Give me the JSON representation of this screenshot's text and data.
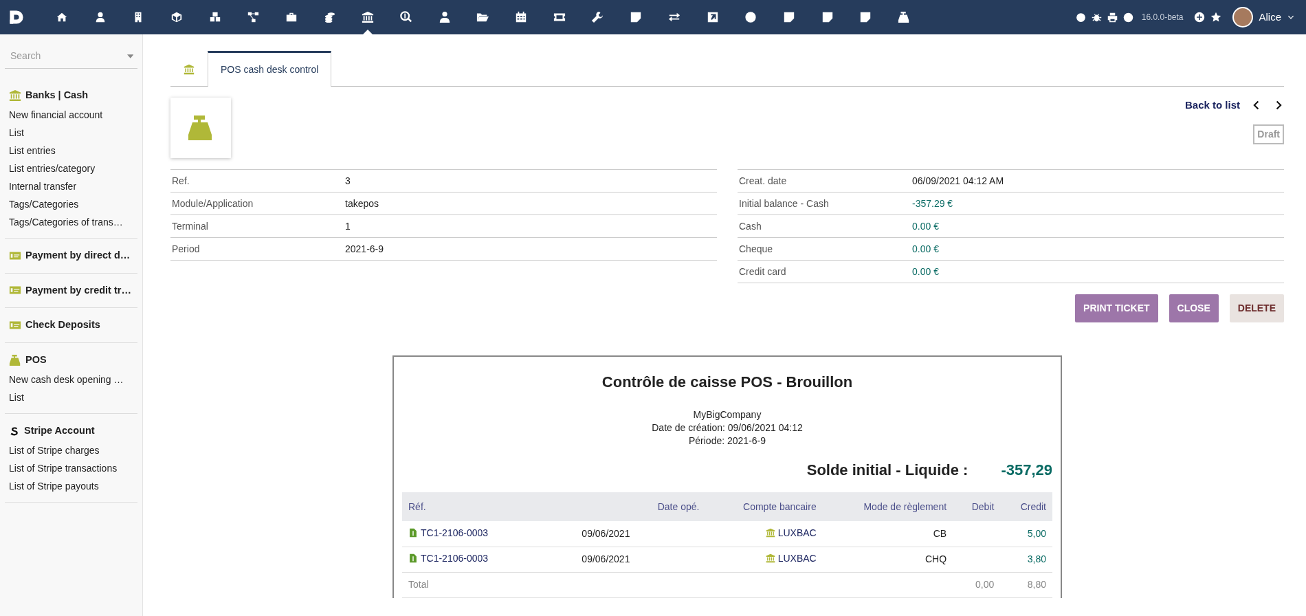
{
  "topbar": {
    "menu": [
      {
        "selected": false
      },
      {
        "selected": false
      },
      {
        "selected": false
      },
      {
        "selected": false
      },
      {
        "selected": false
      },
      {
        "selected": false
      },
      {
        "selected": false
      },
      {
        "selected": false
      },
      {
        "selected": true
      },
      {
        "selected": false
      },
      {
        "selected": false
      },
      {
        "selected": false
      },
      {
        "selected": false
      },
      {
        "selected": false
      },
      {
        "selected": false
      },
      {
        "selected": false
      },
      {
        "selected": false
      },
      {
        "selected": false
      },
      {
        "selected": false
      },
      {
        "selected": false
      },
      {
        "selected": false
      },
      {
        "selected": false
      },
      {
        "selected": false
      }
    ],
    "version": "16.0.0-beta",
    "user": "Alice"
  },
  "sidebar": {
    "search": {
      "placeholder": "Search"
    },
    "sections": [
      {
        "title": "Banks | Cash",
        "kind": "bank",
        "items": [
          "New financial account",
          "List",
          "List entries",
          "List entries/category",
          "Internal transfer",
          "Tags/Categories",
          "Tags/Categories of trans…"
        ]
      },
      {
        "title": "Payment by direct d…",
        "kind": "card"
      },
      {
        "title": "Payment by credit tr…",
        "kind": "card"
      },
      {
        "title": "Check Deposits",
        "kind": "card"
      },
      {
        "title": "POS",
        "kind": "register",
        "items": [
          "New cash desk opening …",
          "List"
        ]
      },
      {
        "title": "Stripe Account",
        "kind": "stripe",
        "items": [
          "List of Stripe charges",
          "List of Stripe transactions",
          "List of Stripe payouts"
        ]
      }
    ]
  },
  "tabs": [
    {
      "kind": "icon",
      "selected": false
    },
    {
      "kind": "text",
      "label": "POS cash desk control",
      "selected": true
    }
  ],
  "back_to_list": "Back to list",
  "status": "Draft",
  "fields_left": [
    {
      "label": "Ref.",
      "value": "3"
    },
    {
      "label": "Module/Application",
      "value": "takepos"
    },
    {
      "label": "Terminal",
      "value": "1"
    },
    {
      "label": "Period",
      "value": "2021-6-9"
    }
  ],
  "fields_right": [
    {
      "label": "Creat. date",
      "value": "06/09/2021 04:12 AM",
      "kind": "text"
    },
    {
      "label": "Initial balance - Cash",
      "value": "-357.29 €",
      "kind": "amount"
    },
    {
      "label": "Cash",
      "value": "0.00 €",
      "kind": "amount"
    },
    {
      "label": "Cheque",
      "value": "0.00 €",
      "kind": "amount"
    },
    {
      "label": "Credit card",
      "value": "0.00 €",
      "kind": "amount"
    }
  ],
  "buttons": [
    {
      "label": "PRINT TICKET",
      "kind": "primary"
    },
    {
      "label": "CLOSE",
      "kind": "primary"
    },
    {
      "label": "DELETE",
      "kind": "danger"
    }
  ],
  "receipt": {
    "title": "Contrôle de caisse POS - Brouillon",
    "company": "MyBigCompany",
    "created": "Date de création: 09/06/2021 04:12",
    "period": "Période: 2021-6-9",
    "balance_label": "Solde initial - Liquide :",
    "balance_value": "-357,29",
    "columns": [
      "Réf.",
      "Date opé.",
      "Compte bancaire",
      "Mode de règlement",
      "Debit",
      "Credit"
    ],
    "rows": [
      {
        "ref": "TC1-2106-0003",
        "date": "09/06/2021",
        "account": "LUXBAC",
        "mode": "CB",
        "debit": "",
        "credit": "5,00"
      },
      {
        "ref": "TC1-2106-0003",
        "date": "09/06/2021",
        "account": "LUXBAC",
        "mode": "CHQ",
        "debit": "",
        "credit": "3,80"
      }
    ],
    "total": {
      "label": "Total",
      "debit": "0,00",
      "credit": "8,80"
    }
  }
}
